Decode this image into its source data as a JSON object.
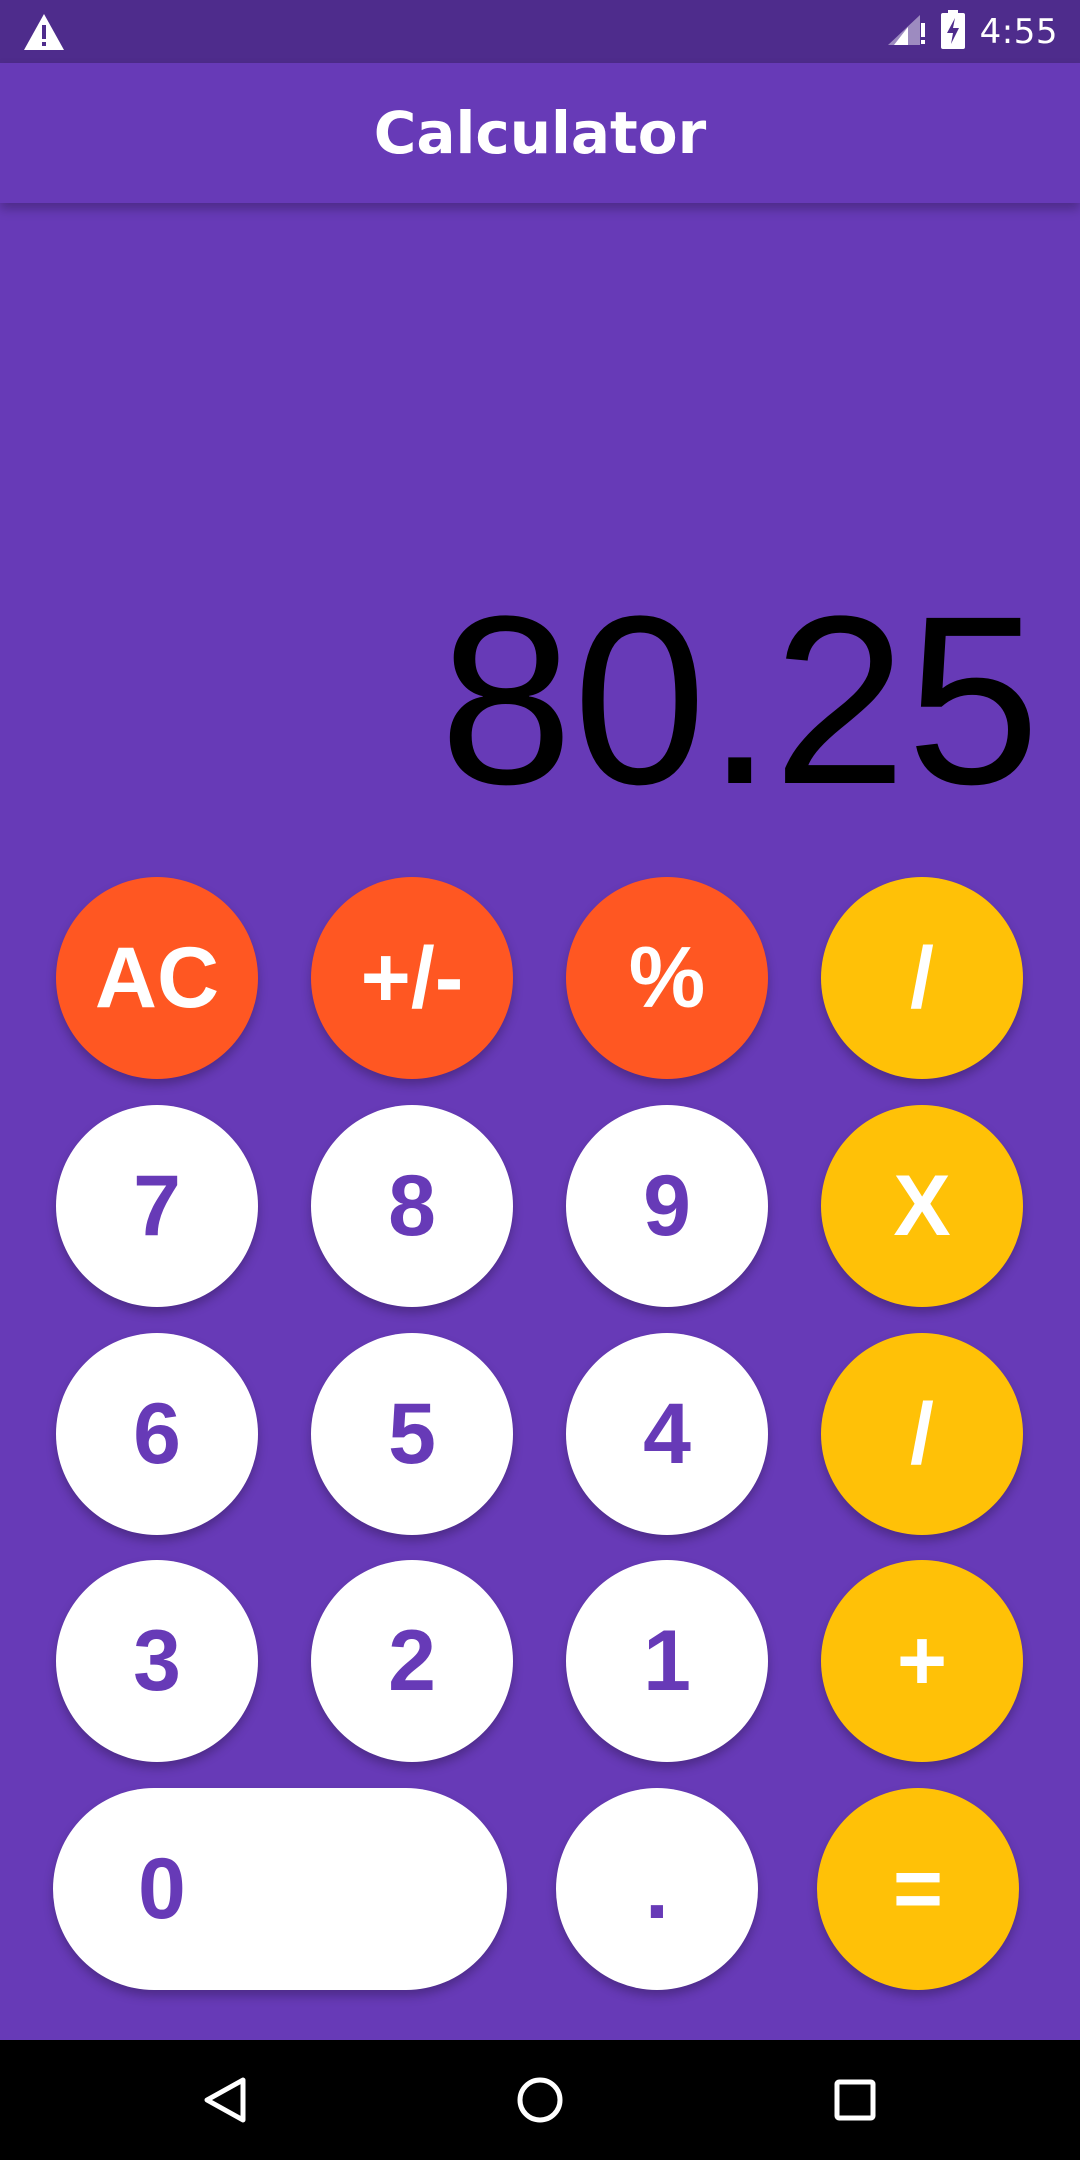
{
  "status_bar": {
    "time": "4:55",
    "icons": [
      "warning-icon",
      "signal-icon",
      "battery-charging-icon"
    ]
  },
  "app_bar": {
    "title": "Calculator"
  },
  "display": {
    "value": "80.25"
  },
  "keypad": {
    "row1": [
      "AC",
      "+/-",
      "%",
      "/"
    ],
    "row2": [
      "7",
      "8",
      "9",
      "X"
    ],
    "row3": [
      "6",
      "5",
      "4",
      "/"
    ],
    "row4": [
      "3",
      "2",
      "1",
      "+"
    ],
    "row5": [
      "0",
      ".",
      "="
    ]
  },
  "navigation": {
    "icons": [
      "back-icon",
      "home-icon",
      "recents-icon"
    ]
  },
  "colors": {
    "primary": "#673AB7",
    "status_bar": "#4E2C8C",
    "function_key": "#FF5722",
    "operator_key": "#FFC107",
    "digit_key": "#FFFFFF"
  }
}
